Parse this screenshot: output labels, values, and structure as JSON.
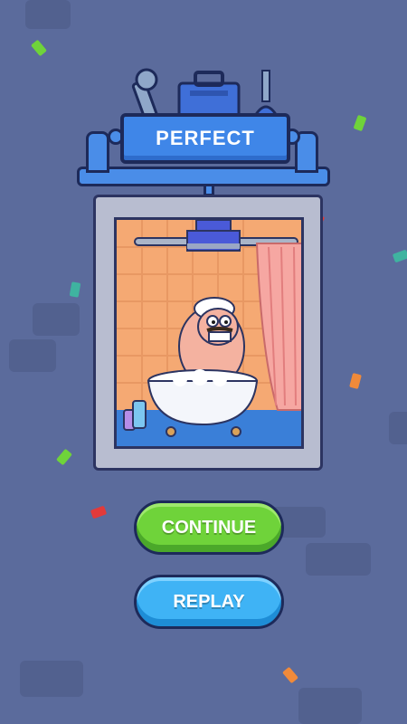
{
  "result": {
    "title": "PERFECT"
  },
  "buttons": {
    "continue_label": "CONTINUE",
    "replay_label": "REPLAY"
  },
  "colors": {
    "background": "#5b6b9c",
    "banner": "#3f86e8",
    "continue": "#6fd33a",
    "replay": "#3fb3f5"
  },
  "scene": {
    "description_icons": [
      "shower-icon",
      "bathtub-icon",
      "chef-character",
      "shower-curtain",
      "soap-bottles"
    ]
  }
}
